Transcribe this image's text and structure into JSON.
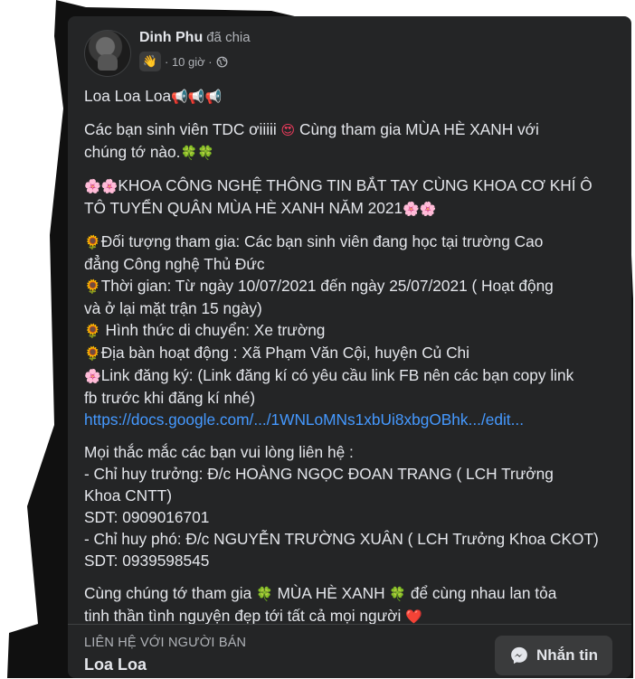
{
  "post": {
    "author": "Dinh Phu",
    "author_suffix": "đã chia",
    "time": "· 10 giờ ·",
    "wave": "👋",
    "paragraphs": [
      {
        "lines": [
          [
            {
              "t": "Loa Loa Loa"
            },
            {
              "e": "📢📢📢",
              "c": "emo-gray"
            }
          ]
        ]
      },
      {
        "lines": [
          [
            {
              "t": "Các bạn sinh viên TDC ơiiiii "
            },
            {
              "e": "😍",
              "c": "emo-red"
            },
            {
              "t": " Cùng tham gia MÙA HÈ XANH với"
            }
          ],
          [
            {
              "t": "chúng tớ nào."
            },
            {
              "e": "🍀🍀",
              "c": "emo-green"
            }
          ]
        ]
      },
      {
        "lines": [
          [
            {
              "e": "🌸🌸",
              "c": "emo-pink"
            },
            {
              "t": "KHOA CÔNG NGHỆ THÔNG TIN BẮT TAY CÙNG KHOA CƠ KHÍ Ô"
            }
          ],
          [
            {
              "t": "TÔ TUYỂN QUÂN MÙA HÈ XANH NĂM 2021"
            },
            {
              "e": "🌸🌸",
              "c": "emo-pink"
            }
          ]
        ]
      },
      {
        "lines": [
          [
            {
              "e": "🌻",
              "c": "emo-yellow"
            },
            {
              "t": "Đối tượng tham gia: Các bạn sinh viên đang học tại trường Cao"
            }
          ],
          [
            {
              "t": "đẳng Công nghệ Thủ Đức"
            }
          ],
          [
            {
              "e": "🌻",
              "c": "emo-yellow"
            },
            {
              "t": "Thời gian: Từ ngày 10/07/2021 đến ngày 25/07/2021 ( Hoạt động"
            }
          ],
          [
            {
              "t": "và ở lại mặt trận 15 ngày)"
            }
          ],
          [
            {
              "e": "🌻",
              "c": "emo-yellow"
            },
            {
              "t": " Hình thức di chuyển: Xe trường"
            }
          ],
          [
            {
              "e": "🌻",
              "c": "emo-yellow"
            },
            {
              "t": "Địa bàn hoạt động : Xã Phạm Văn Cội, huyện Củ Chi"
            }
          ],
          [
            {
              "e": "🌸",
              "c": "emo-pink"
            },
            {
              "t": "Link đăng ký: (Link đăng kí có yêu cầu link FB nên các bạn copy link"
            }
          ],
          [
            {
              "t": "fb trước khi đăng kí nhé)"
            }
          ],
          [
            {
              "l": "https://docs.google.com/.../1WNLoMNs1xbUi8xbgOBhk.../edit..."
            }
          ]
        ]
      },
      {
        "lines": [
          [
            {
              "t": "Mọi thắc mắc các bạn vui lòng liên hệ :"
            }
          ],
          [
            {
              "t": "- Chỉ huy trưởng: Đ/c HOÀNG NGỌC ĐOAN TRANG ( LCH Trưởng"
            }
          ],
          [
            {
              "t": "Khoa CNTT)"
            }
          ],
          [
            {
              "t": "SDT: 0909016701"
            }
          ],
          [
            {
              "t": "- Chỉ huy phó: Đ/c NGUYỄN TRƯỜNG XUÂN ( LCH Trưởng Khoa CKOT)"
            }
          ],
          [
            {
              "t": "SDT: 0939598545"
            }
          ]
        ]
      },
      {
        "lines": [
          [
            {
              "t": "Cùng chúng tớ tham gia "
            },
            {
              "e": "🍀",
              "c": "emo-green"
            },
            {
              "t": " MÙA HÈ XANH "
            },
            {
              "e": "🍀",
              "c": "emo-green"
            },
            {
              "t": " để cùng nhau lan tỏa"
            }
          ],
          [
            {
              "t": "tinh thần tình nguyện đẹp tới tất cả mọi người "
            },
            {
              "e": "❤️",
              "c": "emo-red"
            }
          ]
        ]
      }
    ]
  },
  "footer": {
    "seller_label": "LIÊN HỆ VỚI NGƯỜI BÁN",
    "seller_name": "Loa Loa",
    "message_button": "Nhắn tin"
  },
  "icons": {
    "avatar": "profile-photo",
    "wave": "wave-hand-icon",
    "privacy": "globe-icon",
    "message": "messenger-icon"
  },
  "colors": {
    "card": "#242526",
    "text": "#e4e6eb",
    "secondary": "#b0b3b8",
    "link": "#4599ff",
    "button": "#3a3b3c"
  }
}
